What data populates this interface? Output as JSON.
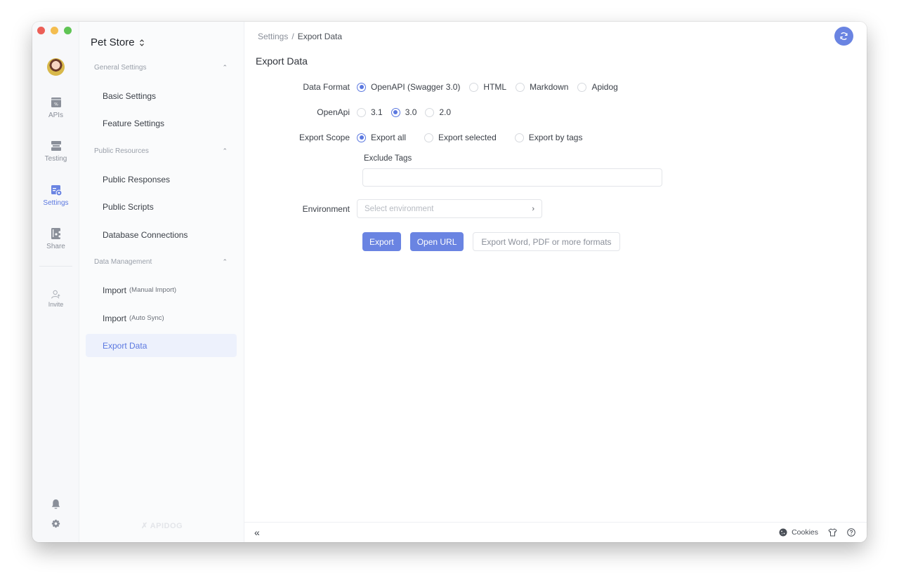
{
  "window": {
    "traffic_lights": [
      "close",
      "minimize",
      "maximize"
    ]
  },
  "rail": {
    "items": [
      {
        "key": "apis",
        "label": "APIs",
        "icon": "api-icon",
        "active": false
      },
      {
        "key": "testing",
        "label": "Testing",
        "icon": "testing-icon",
        "active": false
      },
      {
        "key": "settings",
        "label": "Settings",
        "icon": "settings-page-icon",
        "active": true
      },
      {
        "key": "share",
        "label": "Share",
        "icon": "share-icon",
        "active": false
      },
      {
        "key": "invite",
        "label": "Invite",
        "icon": "invite-user-icon",
        "active": false
      }
    ],
    "bottom_icons": [
      "bell-icon",
      "gear-icon"
    ],
    "accent": "#5b78e0"
  },
  "sidebar": {
    "project_name": "Pet Store",
    "groups": [
      {
        "title": "General Settings",
        "items": [
          {
            "label": "Basic Settings"
          },
          {
            "label": "Feature Settings"
          }
        ]
      },
      {
        "title": "Public Resources",
        "items": [
          {
            "label": "Public Responses"
          },
          {
            "label": "Public Scripts"
          },
          {
            "label": "Database Connections"
          }
        ]
      },
      {
        "title": "Data Management",
        "items": [
          {
            "label": "Import",
            "sub": "(Manual Import)"
          },
          {
            "label": "Import",
            "sub": "(Auto Sync)"
          },
          {
            "label": "Export Data",
            "active": true
          }
        ]
      }
    ],
    "brand": "APIDOG"
  },
  "main": {
    "breadcrumb": {
      "parent": "Settings",
      "separator": "/",
      "current": "Export Data"
    },
    "title": "Export Data",
    "form": {
      "data_format": {
        "label": "Data Format",
        "options": [
          "OpenAPI (Swagger 3.0)",
          "HTML",
          "Markdown",
          "Apidog"
        ],
        "selected": "OpenAPI (Swagger 3.0)"
      },
      "openapi": {
        "label": "OpenApi",
        "options": [
          "3.1",
          "3.0",
          "2.0"
        ],
        "selected": "3.0"
      },
      "export_scope": {
        "label": "Export Scope",
        "options": [
          "Export all",
          "Export selected",
          "Export by tags"
        ],
        "selected": "Export all"
      },
      "exclude_tags": {
        "label": "Exclude Tags",
        "value": ""
      },
      "environment": {
        "label": "Environment",
        "placeholder": "Select environment",
        "value": ""
      }
    },
    "buttons": {
      "export": "Export",
      "open_url": "Open URL",
      "more_formats": "Export Word, PDF or more formats"
    },
    "footer": {
      "cookies": "Cookies"
    },
    "primary_color": "#6a84e2"
  }
}
